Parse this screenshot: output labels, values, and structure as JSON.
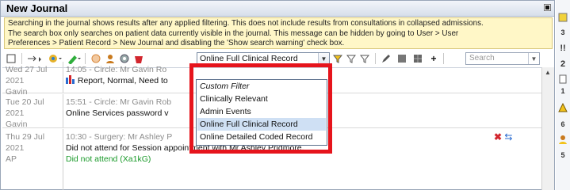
{
  "window": {
    "title": "New Journal"
  },
  "warning": {
    "lines": [
      "Searching in the journal shows results after any applied filtering. This does not include results from consultations in collapsed admissions.",
      "The search box only searches on patient data currently visible in the journal. This message can be hidden by going to User > User",
      "Preferences > Patient Record > New Journal and disabling the 'Show search warning' check box."
    ]
  },
  "toolbar": {
    "filter_value": "Online Full Clinical Record",
    "search_placeholder": "Search"
  },
  "dropdown": {
    "items": [
      "Custom Filter",
      "Clinically Relevant",
      "Admin Events",
      "Online Full Clinical Record",
      "Online Detailed Coded Record"
    ],
    "selected": "Online Full Clinical Record"
  },
  "journal": {
    "rows": [
      {
        "date": "Wed 27 Jul 2021",
        "who": "Gavin",
        "header": "14:05 - Circle: Mr Gavin Ro",
        "text": "Report, Normal, Need to"
      },
      {
        "date": "Tue 20 Jul 2021",
        "who": "Gavin",
        "header": "15:51 - Circle: Mr Gavin Rob",
        "text": "Online Services password v"
      },
      {
        "date": "Thu 29 Jul 2021",
        "who": "AP",
        "header": "10:30 - Surgery: Mr Ashley P",
        "text": "Did not attend for Session appointment with Mr Ashley Pridmore.",
        "code": "Did not attend (Xa1kG)"
      }
    ]
  },
  "sidebar": {
    "items": [
      "3",
      "!!",
      "2",
      "1",
      "6",
      "5"
    ]
  },
  "colors": {
    "highlight": "#e6141c",
    "warning_bg": "#fff7c7",
    "code_green": "#1a9a2a"
  }
}
